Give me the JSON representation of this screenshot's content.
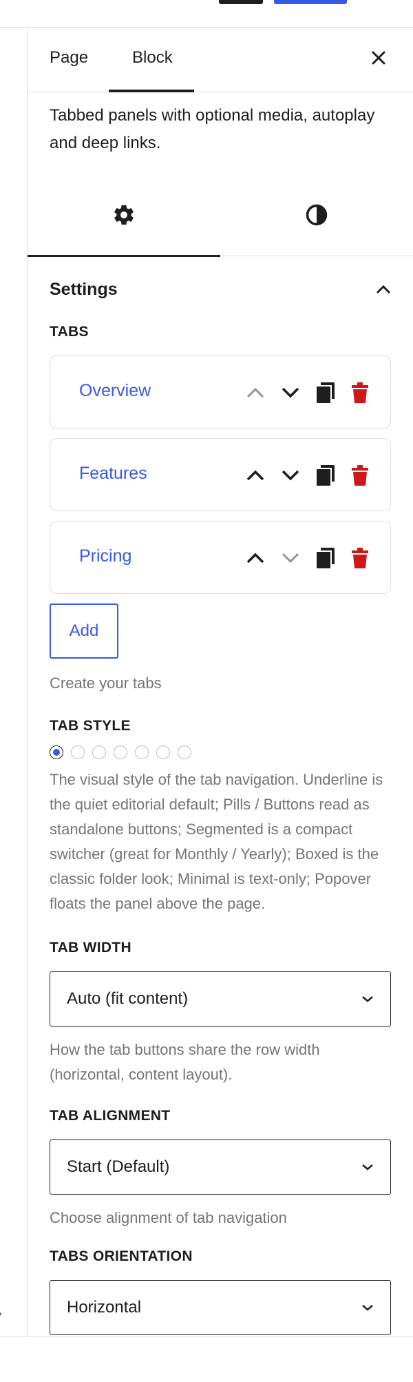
{
  "sidebar": {
    "tabs": {
      "page": "Page",
      "block": "Block"
    },
    "description": "Tabbed panels with optional media, autoplay and deep links.",
    "icons": {
      "settings": "gear-icon",
      "styles": "contrast-icon"
    },
    "panel_title": "Settings"
  },
  "tabs_section": {
    "label": "TABS",
    "items": [
      {
        "label": "Overview",
        "up_disabled": true,
        "down_disabled": false
      },
      {
        "label": "Features",
        "up_disabled": false,
        "down_disabled": false
      },
      {
        "label": "Pricing",
        "up_disabled": false,
        "down_disabled": true
      }
    ],
    "add_label": "Add",
    "help": "Create your tabs"
  },
  "tab_style": {
    "label": "TAB STYLE",
    "option_count": 7,
    "selected_index": 0,
    "help": "The visual style of the tab navigation. Underline is the quiet editorial default; Pills / Buttons read as standalone buttons; Segmented is a compact switcher (great for Monthly / Yearly); Boxed is the classic folder look; Minimal is text-only; Popover floats the panel above the page."
  },
  "tab_width": {
    "label": "TAB WIDTH",
    "value": "Auto (fit content)",
    "help": "How the tab buttons share the row width (horizontal, content layout)."
  },
  "tab_alignment": {
    "label": "TAB ALIGNMENT",
    "value": "Start (Default)",
    "help": "Choose alignment of tab navigation"
  },
  "tabs_orientation": {
    "label": "TABS ORIENTATION",
    "value": "Horizontal"
  },
  "colors": {
    "accent": "#3858e9",
    "delete": "#cc1818",
    "text": "#1e1e1e",
    "muted": "#757575",
    "border": "#dddddd"
  }
}
